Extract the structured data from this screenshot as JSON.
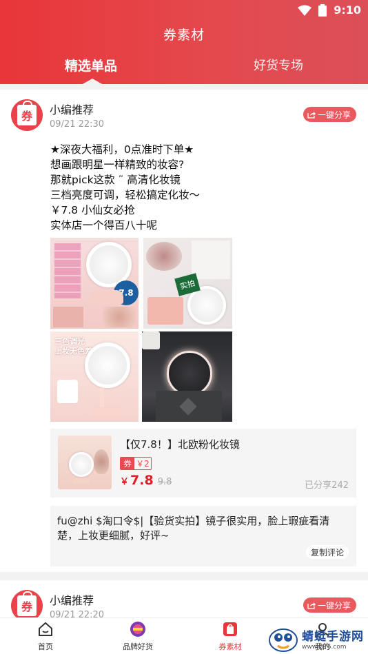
{
  "status_bar": {
    "time": "9:10"
  },
  "header": {
    "title": "券素材",
    "tabs": [
      {
        "label": "精选单品",
        "active": true
      },
      {
        "label": "好货专场",
        "active": false
      }
    ]
  },
  "posts": [
    {
      "author": "小编推荐",
      "time": "09/21 22:30",
      "share_label": "一键分享",
      "content_lines": [
        "★深夜大福利，0点准时下单★",
        "想画跟明星一样精致的妆容?",
        "那就pick这款 ˜ 高清化妆镜",
        "三档亮度可调，轻松搞定化妆～",
        "￥7.8     小仙女必抢",
        "实体店一个得百八十呢"
      ],
      "images": {
        "img1_price": "7.8",
        "img2_badge": "实拍",
        "img3_text_1": "三色调光",
        "img3_text_2": "上妆无色差"
      },
      "product": {
        "title": "【仅7.8！】北欧粉化妆镜",
        "coupon_label": "券",
        "coupon_value": "￥2",
        "price_currency": "￥",
        "price": "7.8",
        "original_price": "9.8",
        "shared_count": "已分享242"
      },
      "comment": {
        "text": "fu@zhi     $淘口令$|【验货实拍】镜子很实用，脸上瑕疵看清楚，上妆更细腻，好评~",
        "copy_label": "复制评论"
      }
    },
    {
      "author": "小编推荐",
      "time": "09/21 22:20",
      "share_label": "一键分享"
    }
  ],
  "bottom_nav": [
    {
      "label": "首页",
      "icon": "home-icon",
      "active": false
    },
    {
      "label": "品牌好货",
      "icon": "brand-icon",
      "active": false
    },
    {
      "label": "券素材",
      "icon": "coupon-bag-icon",
      "active": true
    },
    {
      "label": "我的",
      "icon": "user-icon",
      "active": false
    }
  ],
  "watermark": {
    "name": "蜻蜓手游网",
    "url": "www.QT6.com"
  },
  "colors": {
    "brand_red": "#e8363a",
    "price_red": "#e31e28"
  }
}
